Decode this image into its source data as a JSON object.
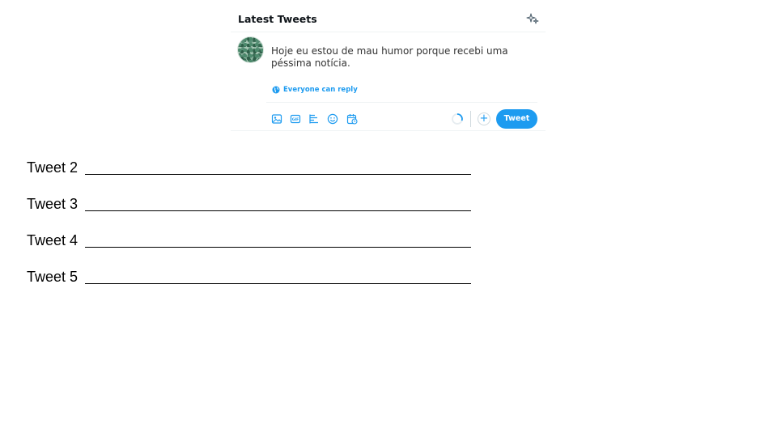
{
  "composer": {
    "title": "Latest Tweets",
    "tweet_text": "Hoje eu estou de mau humor porque recebi uma péssima notícia.",
    "reply_setting": "Everyone can reply",
    "tweet_button": "Tweet",
    "add_button": "+",
    "accent_color": "#1d9bf0",
    "icons": [
      "sparkle-icon",
      "globe-icon",
      "image-icon",
      "gif-icon",
      "poll-icon",
      "emoji-icon",
      "schedule-icon",
      "progress-ring-icon"
    ]
  },
  "worksheet": {
    "lines": [
      {
        "label": "Tweet 2"
      },
      {
        "label": "Tweet 3"
      },
      {
        "label": "Tweet 4"
      },
      {
        "label": "Tweet 5"
      }
    ]
  }
}
